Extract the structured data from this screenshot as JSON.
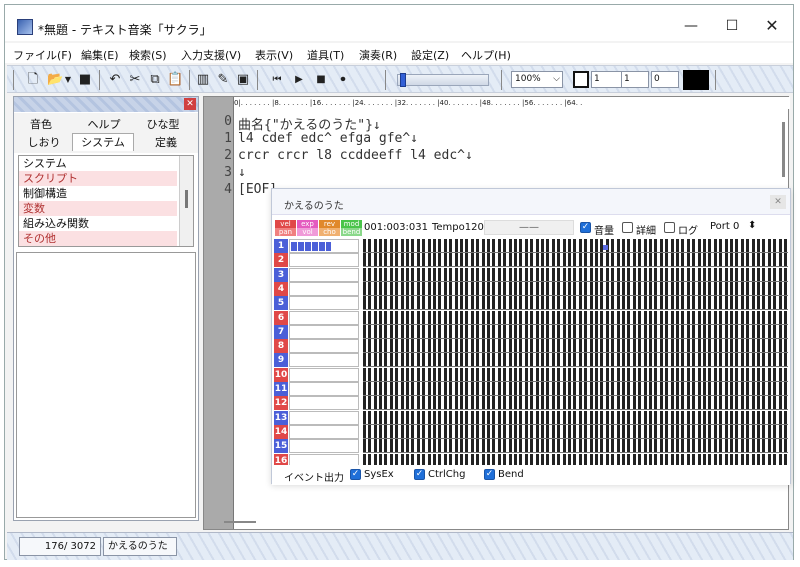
{
  "window": {
    "title": "*無題 - テキスト音楽「サクラ」"
  },
  "menu": [
    "ファイル(F)",
    "編集(E)",
    "検索(S)",
    "入力支援(V)",
    "表示(V)",
    "道具(T)",
    "演奏(R)",
    "設定(Z)",
    "ヘルプ(H)"
  ],
  "toolbar": {
    "zoom": "100%",
    "field1": "1",
    "field2": "1",
    "field3": "0",
    "icons": [
      "new-file-icon",
      "open-folder-icon",
      "dropdown-arrow-icon",
      "save-icon",
      "undo-icon",
      "cut-icon",
      "copy-icon",
      "paste-icon",
      "keyboard-icon",
      "edit-pencil-icon",
      "image-icon",
      "play-start-icon",
      "play-icon",
      "stop-icon",
      "record-icon"
    ]
  },
  "left_panel": {
    "tabs_row1": [
      "音色",
      "ヘルプ",
      "ひな型"
    ],
    "tabs_row2": [
      "しおり",
      "システム",
      "定義"
    ],
    "active_tab": "システム",
    "categories": [
      "システム",
      "スクリプト",
      "制御構造",
      "変数",
      "組み込み関数",
      "その他"
    ]
  },
  "editor": {
    "ruler": "0|. . . . . . . |8. . . . . . . |16. . . . . . . |24. . . . . . . |32. . . . . . . |40. . . . . . . |48. . . . . . . |56. . . . . . . |64. .",
    "lines": [
      {
        "num": "0",
        "text": "曲名{\"かえるのうた\"}↓"
      },
      {
        "num": "1",
        "text": "l4 cdef edc^ efga gfe^↓"
      },
      {
        "num": "2",
        "text": "crcr crcr l8 ccddeeff l4 edc^↓"
      },
      {
        "num": "3",
        "text": "↓"
      },
      {
        "num": "4",
        "text": "[EOF]"
      }
    ]
  },
  "midi_monitor": {
    "title": "かえるのうた",
    "mini_labels": [
      "vel",
      "exp",
      "rev",
      "mod",
      "pan",
      "vol",
      "cho",
      "bend"
    ],
    "time": "001:003:031",
    "tempo": "Tempo120",
    "dash": "——",
    "volume_label": "音量",
    "volume_checked": true,
    "detail_label": "詳細",
    "detail_checked": false,
    "log_label": "ログ",
    "log_checked": false,
    "port_label": "Port",
    "port_value": "0",
    "channels": [
      "1",
      "2",
      "3",
      "4",
      "5",
      "6",
      "7",
      "8",
      "9",
      "10",
      "11",
      "12",
      "13",
      "14",
      "15",
      "16"
    ],
    "event_label": "イベント出力",
    "sysex_label": "SysEx",
    "ctrlchg_label": "CtrlChg",
    "bend_label": "Bend"
  },
  "status": {
    "position": "176/ 3072",
    "song": "かえるのうた"
  },
  "colors": {
    "accent_blue": "#1f6fd8",
    "channel_blue": "#4b5fd8",
    "channel_red": "#e04848",
    "list_pink": "#fbe0e2"
  }
}
